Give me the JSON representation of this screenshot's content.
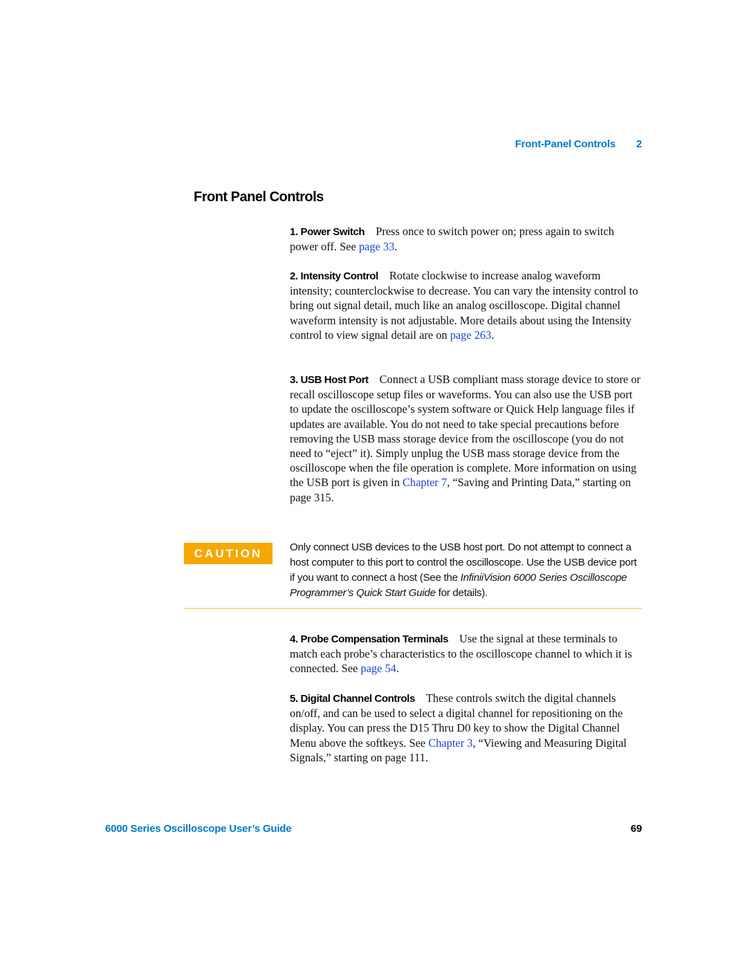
{
  "running_head": {
    "chapter_title": "Front-Panel Controls",
    "chapter_number": "2"
  },
  "section_title": "Front Panel Controls",
  "items": [
    {
      "lead": "1. Power Switch",
      "text_before": "Press once to switch power on; press again to switch power off. See ",
      "link": "page 33",
      "text_after": "."
    },
    {
      "lead": "2. Intensity Control",
      "text_before": "Rotate clockwise to increase analog waveform intensity; counterclockwise to decrease. You can vary the intensity control to bring out signal detail, much like an analog oscilloscope. Digital channel waveform intensity is not adjustable. More details about using the Intensity control to view signal detail are on ",
      "link": "page 263",
      "text_after": "."
    },
    {
      "lead": "3. USB Host Port",
      "text_before": "Connect a USB compliant mass storage device to store or recall oscilloscope setup files or waveforms. You can also use the USB port to update the oscilloscope’s system software or Quick Help language files if updates are available. You do not need to take special precautions before removing the USB mass storage device from the oscilloscope (you do not need to “eject” it). Simply unplug the USB mass storage device from the oscilloscope when the file operation is complete. More information on using the USB port is given in ",
      "link": "Chapter 7",
      "text_after": ", “Saving and Printing Data,” starting on page 315."
    },
    {
      "lead": "4. Probe Compensation Terminals",
      "text_before": "Use the signal at these terminals to match each probe’s characteristics to the oscilloscope channel to which it is connected. See ",
      "link": "page 54",
      "text_after": "."
    },
    {
      "lead": "5. Digital Channel Controls",
      "text_before": "These controls switch the digital channels on/off, and can be used to select a digital channel for repositioning on the display. You can press the D15 Thru D0 key to show the Digital Channel Menu above the softkeys. See ",
      "link": "Chapter 3",
      "text_after": ", “Viewing and Measuring Digital Signals,” starting on page 111."
    }
  ],
  "caution": {
    "label": "CAUTION",
    "text_before": "Only connect USB devices to the USB host port. Do not attempt to connect a host computer to this port to control the oscilloscope. Use the USB device port if you want to connect a host (See the ",
    "italic": "InfiniiVision 6000 Series Oscilloscope Programmer’s Quick Start Guide",
    "text_after": " for details).",
    "badge_color": "#f5a800",
    "divider_color": "#fdd98c"
  },
  "footer": {
    "book_title": "6000 Series Oscilloscope User’s Guide",
    "page_number": "69"
  },
  "colors": {
    "heading_blue": "#0078c8",
    "link_blue": "#1a44d0"
  }
}
